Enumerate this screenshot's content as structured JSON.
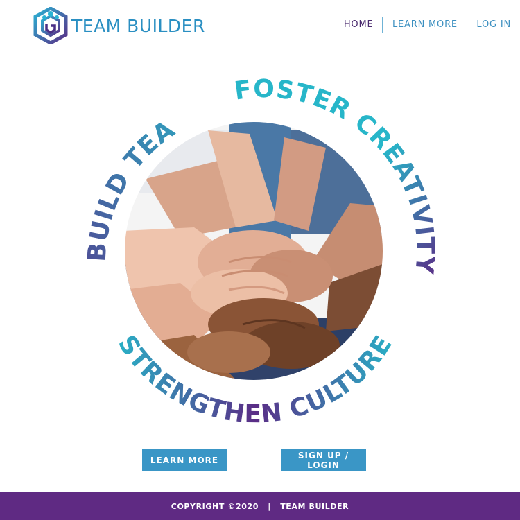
{
  "brand": {
    "name": "TEAM BUILDER",
    "logo_icon": "team-builder-shield-logo"
  },
  "nav": {
    "items": [
      {
        "label": "HOME",
        "active": true
      },
      {
        "label": "LEARN MORE",
        "active": false
      },
      {
        "label": "LOG IN",
        "active": false
      }
    ]
  },
  "hero": {
    "image_description_icon": "stacked-hands-photo",
    "slogans": {
      "left": "BUILD TEAMS",
      "top_right": "FOSTER CREATIVITY",
      "bottom": "STRENGTHEN CULTURE"
    }
  },
  "buttons": {
    "learn_more": "LEARN MORE",
    "sign_up_login": "SIGN UP / LOGIN"
  },
  "footer": {
    "copyright": "COPYRIGHT ©2020",
    "separator": "|",
    "company": "TEAM BUILDER"
  },
  "colors": {
    "accent_blue": "#3a96c6",
    "teal": "#27b6c9",
    "purple": "#5f2a83",
    "nav_active": "#4a2a6e"
  }
}
